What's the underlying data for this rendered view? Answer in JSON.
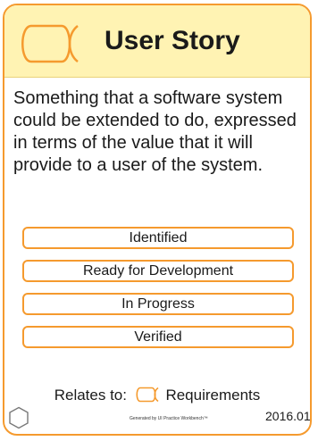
{
  "card": {
    "title": "User Story",
    "icon": "alpha-icon",
    "description": "Something that a software system could be extended to do, expressed in terms of the value that it will provide to a user of the system.",
    "states": [
      {
        "label": "Identified"
      },
      {
        "label": "Ready for Development"
      },
      {
        "label": "In Progress"
      },
      {
        "label": "Verified"
      }
    ],
    "relates": {
      "prefix": "Relates to:",
      "target": "Requirements",
      "icon": "alpha-icon"
    },
    "footer": {
      "generated": "Generated by UI Practice Workbench™",
      "version": "2016.01",
      "icon": "hexagon-icon"
    },
    "colors": {
      "accent": "#f59a2e",
      "header_bg": "#fff3b3",
      "text": "#1a1a1a"
    }
  }
}
